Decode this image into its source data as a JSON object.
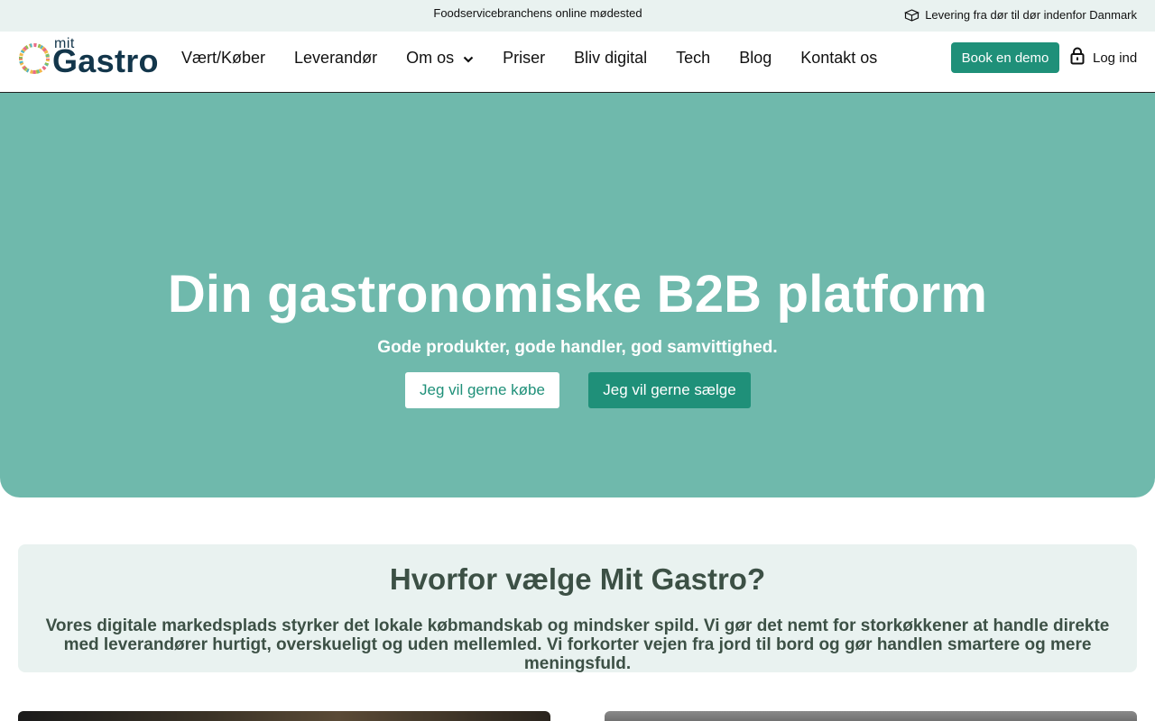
{
  "topbar": {
    "tagline": "Foodservicebranchens online mødested",
    "delivery_text": "Levering fra dør til dør indenfor Danmark",
    "delivery_icon": "box-icon"
  },
  "header": {
    "logo_small": "mit",
    "logo_large": "Gastro",
    "nav": [
      {
        "label": "Vært/Køber"
      },
      {
        "label": "Leverandør"
      },
      {
        "label": "Om os"
      },
      {
        "label": "Priser"
      },
      {
        "label": "Bliv digital"
      },
      {
        "label": "Tech"
      },
      {
        "label": "Blog"
      },
      {
        "label": "Kontakt os"
      }
    ],
    "demo_label": "Book en demo",
    "login_label": "Log ind"
  },
  "hero": {
    "title": "Din gastronomiske B2B platform",
    "subtitle": "Gode produkter, gode handler, god samvittighed.",
    "buy_label": "Jeg vil gerne købe",
    "sell_label": "Jeg vil gerne sælge"
  },
  "why": {
    "title": "Hvorfor vælge Mit Gastro?",
    "text": "Vores digitale markedsplads styrker det lokale købmandskab og mindsker spild. Vi gør det nemt for storkøkkener at handle direkte med leverandører hurtigt, overskueligt og uden mellemled. Vi forkorter vejen fra jord til bord og gør handlen smartere og mere meningsfuld."
  },
  "colors": {
    "accent": "#1f9079",
    "hero_bg": "#6fb9ac",
    "soft_bg": "#e9f2f0",
    "logo_text": "#13364b",
    "why_text": "#3c5045"
  }
}
